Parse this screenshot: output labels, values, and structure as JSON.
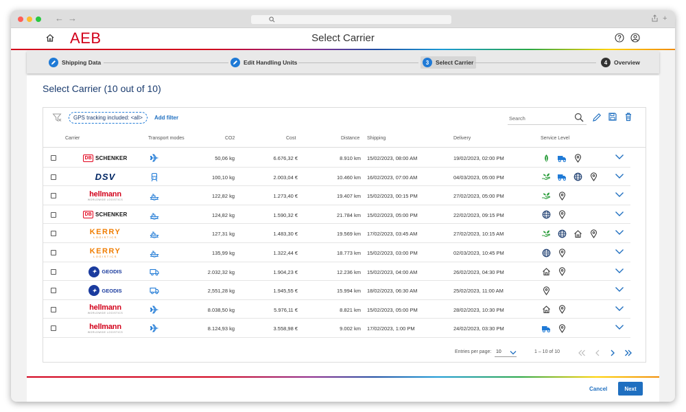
{
  "app": {
    "logo_text": "AEB",
    "page_title": "Select Carrier"
  },
  "stepper": {
    "steps": [
      {
        "label": "Shipping Data",
        "status": "done"
      },
      {
        "label": "Edit Handling Units",
        "status": "done"
      },
      {
        "label": "Select Carrier",
        "status": "active",
        "number": "3"
      },
      {
        "label": "Overview",
        "status": "pending",
        "number": "4"
      }
    ]
  },
  "main": {
    "title": "Select Carrier (10 out of 10)",
    "filter_chip": "GPS tracking included: <all>",
    "add_filter": "Add filter",
    "search_placeholder": "Search"
  },
  "table": {
    "headers": {
      "carrier": "Carrier",
      "transport_modes": "Transport modes",
      "co2": "CO2",
      "cost": "Cost",
      "distance": "Distance",
      "shipping": "Shipping",
      "delivery": "Delivery",
      "service_level": "Service Level"
    },
    "rows": [
      {
        "carrier": "schenker",
        "mode": "plane-icon",
        "co2": "50,06 kg",
        "cost": "6.676,32 €",
        "distance": "8.910 km",
        "shipping": "15/02/2023, 08:00 AM",
        "delivery": "19/02/2023, 02:00 PM",
        "services": [
          "eco-leaf-icon",
          "truck-icon",
          "location-pin-icon"
        ]
      },
      {
        "carrier": "dsv",
        "mode": "train-icon",
        "co2": "100,10 kg",
        "cost": "2.003,04 €",
        "distance": "10.460 km",
        "shipping": "16/02/2023, 07:00 AM",
        "delivery": "04/03/2023, 05:00 PM",
        "services": [
          "green-hand-icon",
          "truck-icon",
          "globe-icon",
          "location-pin-icon"
        ]
      },
      {
        "carrier": "hellmann",
        "mode": "ship-icon",
        "co2": "122,82 kg",
        "cost": "1.273,40 €",
        "distance": "19.407 km",
        "shipping": "15/02/2023, 00:15 PM",
        "delivery": "27/02/2023, 05:00 PM",
        "services": [
          "green-hand-icon",
          "location-pin-icon"
        ]
      },
      {
        "carrier": "schenker",
        "mode": "ship-icon",
        "co2": "124,82 kg",
        "cost": "1.590,32 €",
        "distance": "21.784 km",
        "shipping": "15/02/2023, 05:00 PM",
        "delivery": "22/02/2023, 09:15 PM",
        "services": [
          "globe-icon",
          "location-pin-icon"
        ]
      },
      {
        "carrier": "kerry",
        "mode": "ship-icon",
        "co2": "127,31 kg",
        "cost": "1.483,30 €",
        "distance": "19.569 km",
        "shipping": "17/02/2023, 03:45 AM",
        "delivery": "27/02/2023, 10:15 AM",
        "services": [
          "green-hand-icon",
          "globe-icon",
          "house-icon",
          "location-pin-icon"
        ]
      },
      {
        "carrier": "kerry",
        "mode": "ship-icon",
        "co2": "135,99 kg",
        "cost": "1.322,44 €",
        "distance": "18.773 km",
        "shipping": "15/02/2023, 03:00 PM",
        "delivery": "02/03/2023, 10:45 PM",
        "services": [
          "globe-icon",
          "location-pin-icon"
        ]
      },
      {
        "carrier": "geodis",
        "mode": "truck-icon",
        "co2": "2.032,32 kg",
        "cost": "1.904,23 €",
        "distance": "12.236 km",
        "shipping": "15/02/2023, 04:00 AM",
        "delivery": "26/02/2023, 04:30 PM",
        "services": [
          "house-icon",
          "location-pin-icon"
        ]
      },
      {
        "carrier": "geodis",
        "mode": "truck-icon",
        "co2": "2,551,28 kg",
        "cost": "1.945,55 €",
        "distance": "15.994 km",
        "shipping": "18/02/2023, 06:30 AM",
        "delivery": "25/02/2023, 11:00 AM",
        "services": [
          "location-pin-icon"
        ]
      },
      {
        "carrier": "hellmann",
        "mode": "plane-icon",
        "co2": "8.038,50 kg",
        "cost": "5.976,11 €",
        "distance": "8.821 km",
        "shipping": "15/02/2023, 05:00 PM",
        "delivery": "28/02/2023, 10:30 PM",
        "services": [
          "house-icon",
          "location-pin-icon"
        ]
      },
      {
        "carrier": "hellmann",
        "mode": "plane-icon",
        "co2": "8.124,93 kg",
        "cost": "3.558,98 €",
        "distance": "9.002 km",
        "shipping": "17/02/2023, 1:00 PM",
        "delivery": "24/02/2023, 03:30 PM",
        "services": [
          "truck-icon",
          "location-pin-icon"
        ]
      }
    ]
  },
  "carriers": {
    "schenker": {
      "db": "DB",
      "name": "SCHENKER"
    },
    "dsv": {
      "name": "DSV"
    },
    "hellmann": {
      "name": "hellmann",
      "sub": "WORLDWIDE LOGISTICS"
    },
    "kerry": {
      "name": "KERRY",
      "sub": "LOGISTICS"
    },
    "geodis": {
      "name": "GEODIS"
    }
  },
  "pagination": {
    "entries_label": "Entries per page:",
    "entries_value": "10",
    "range": "1 – 10 of 10"
  },
  "footer": {
    "cancel": "Cancel",
    "next": "Next"
  },
  "colors": {
    "accent": "#1f6fc0",
    "brand": "#d2001a",
    "service_green": "#2e9e3e",
    "icon_blue": "#1f7ad6"
  }
}
